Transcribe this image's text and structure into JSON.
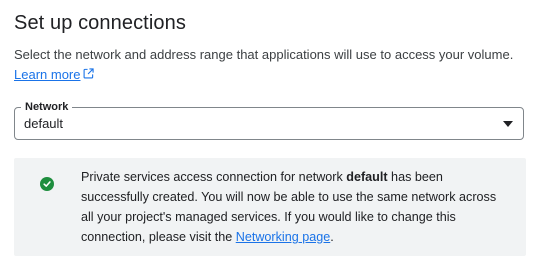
{
  "header": {
    "title": "Set up connections"
  },
  "description": {
    "text": "Select the network and address range that applications will use to access your volume.",
    "learn_more": "Learn more"
  },
  "network_select": {
    "label": "Network",
    "value": "default"
  },
  "notice": {
    "text_before": "Private services access connection for network ",
    "network_name": "default",
    "text_after": " has been successfully created. You will now be able to use the same network across all your project's managed services. If you would like to change this connection, please visit the ",
    "link_label": "Networking page",
    "text_end": "."
  },
  "colors": {
    "link": "#1a73e8",
    "success": "#1e8e3e",
    "notice_bg": "#f1f3f4"
  },
  "icons": {
    "external_link": "open-in-new-icon",
    "success": "check-circle-icon",
    "dropdown": "arrow-drop-down-icon"
  }
}
